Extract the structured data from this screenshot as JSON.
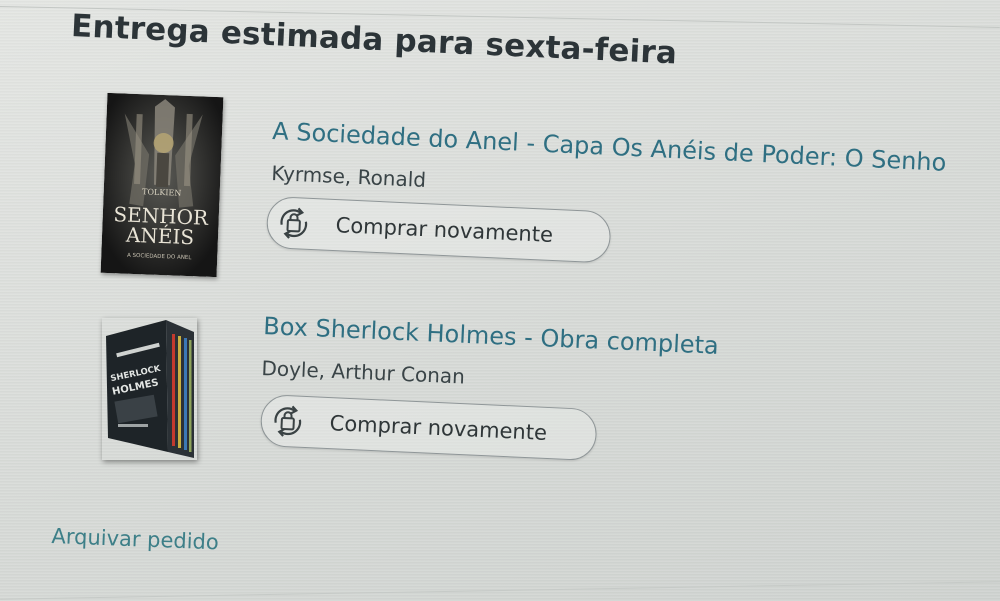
{
  "section": {
    "title": "Entrega estimada para sexta-feira"
  },
  "products": [
    {
      "title": "A Sociedade do Anel - Capa Os Anéis de Poder: O Senho",
      "author": "Kyrmse, Ronald",
      "buy_again_label": "Comprar novamente",
      "cover": {
        "author_text": "TOLKIEN",
        "title_text_1": "SENHOR",
        "title_text_2": "ANÉIS",
        "subtitle_text": "A SOCIEDADE DO ANEL"
      }
    },
    {
      "title": "Box Sherlock Holmes - Obra completa",
      "author": "Doyle, Arthur Conan",
      "buy_again_label": "Comprar novamente",
      "cover": {
        "title_text_1": "SHERLOCK",
        "title_text_2": "HOLMES"
      }
    }
  ],
  "footer": {
    "archive_label": "Arquivar pedido"
  },
  "colors": {
    "background": "#d9dcd9",
    "link": "#2f6f82",
    "title": "#2c3438"
  },
  "icons": {
    "buy_again": "reorder-bag-icon"
  }
}
